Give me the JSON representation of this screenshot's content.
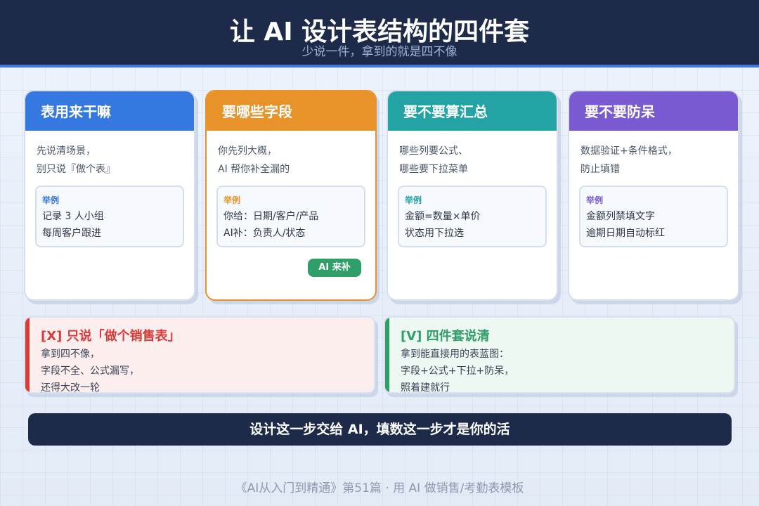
{
  "header": {
    "title": "让 AI 设计表结构的四件套",
    "subtitle": "少说一件，拿到的就是四不像"
  },
  "colors": {
    "navy": "#1e2a4a",
    "blue": "#3478e0",
    "orange": "#e8922a",
    "teal": "#23a3a3",
    "purple": "#7a5ad0",
    "red": "#d93a3a",
    "green": "#2f9e68"
  },
  "cards": [
    {
      "title": "表用来干嘛",
      "desc": [
        "先说清场景，",
        "别只说『做个表』"
      ],
      "example_label": "举例",
      "example": [
        "记录 3 人小组",
        "每周客户跟进"
      ]
    },
    {
      "title": "要哪些字段",
      "desc": [
        "你先列大概，",
        "AI 帮你补全漏的"
      ],
      "example_label": "举例",
      "example": [
        "你给：日期/客户/产品",
        "AI补：负责人/状态"
      ],
      "badge": "AI 来补"
    },
    {
      "title": "要不要算汇总",
      "desc": [
        "哪些列要公式、",
        "哪些要下拉菜单"
      ],
      "example_label": "举例",
      "example": [
        "金额=数量×单价",
        "状态用下拉选"
      ]
    },
    {
      "title": "要不要防呆",
      "desc": [
        "数据验证+条件格式，",
        "防止填错"
      ],
      "example_label": "举例",
      "example": [
        "金额列禁填文字",
        "逾期日期自动标红"
      ]
    }
  ],
  "compare": {
    "bad": {
      "title": "[X] 只说「做个销售表」",
      "lines": [
        "拿到四不像，",
        "字段不全、公式漏写，",
        "还得大改一轮"
      ]
    },
    "good": {
      "title": "[V] 四件套说清",
      "lines": [
        "拿到能直接用的表蓝图：",
        "字段+公式+下拉+防呆，",
        "照着建就行"
      ]
    }
  },
  "banner": "设计这一步交给 AI，填数这一步才是你的活",
  "footer": "《AI从入门到精通》第51篇 · 用 AI 做销售/考勤表模板"
}
